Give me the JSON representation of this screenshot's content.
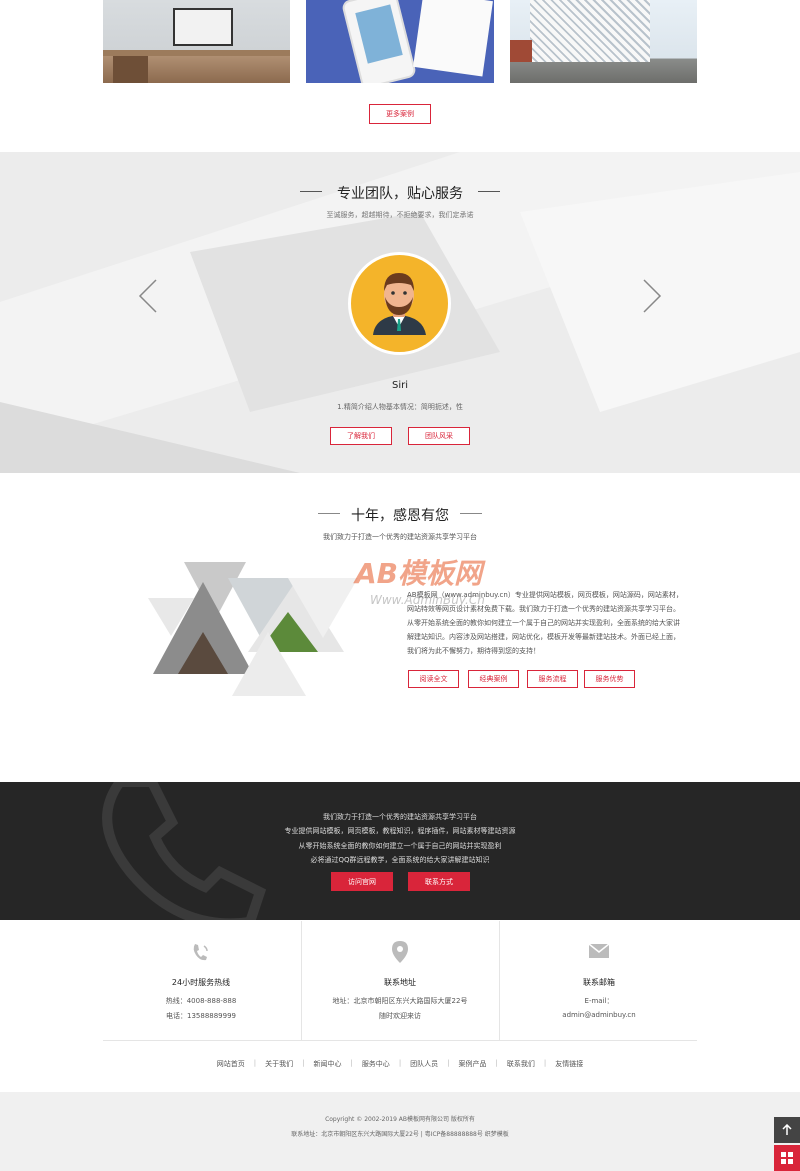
{
  "portfolio": {
    "more_label": "更多案例"
  },
  "team": {
    "title": "专业团队，贴心服务",
    "subtitle": "至诚服务，超越期待，不拒绝要求，我们定承诺",
    "member_name": "Siri",
    "member_desc": "1.精简介绍人物基本情况：简明扼述，性",
    "btn_about": "了解我们",
    "btn_style": "团队风采"
  },
  "about": {
    "title": "十年，感恩有您",
    "subtitle": "我们致力于打造一个优秀的建站资源共享学习平台",
    "text_lines": [
      "AB模板网（www.adminbuy.cn）专业提供网站模板，网页模板，网站源码，网站素材，",
      "网站特效等网页设计素材免费下载。我们致力于打造一个优秀的建站资源共享学习平台。",
      "从零开始系统全面的教你如何建立一个属于自己的网站并实现盈利，全面系统的给大家讲",
      "解建站知识。内容涉及网站搭建，网站优化，模板开发等最新建站技术。外面已经上面，",
      "我们将为此不懈努力，期待得到您的支持！"
    ],
    "buttons": [
      "阅读全文",
      "经典案例",
      "服务流程",
      "服务优势"
    ],
    "watermark_logo": "AB模板网",
    "watermark_url": "Www.AdminBuy.Cn"
  },
  "band": {
    "lines": [
      "我们致力于打造一个优秀的建站资源共享学习平台",
      "专业提供网站模板，网页模板，教程知识，程序插件，网站素材等建站资源",
      "从零开始系统全面的教你如何建立一个属于自己的网站并实现盈利",
      "必将通过QQ群远程教学，全面系统的给大家讲解建站知识"
    ],
    "btn_official": "访问官网",
    "btn_contact": "联系方式"
  },
  "contact": {
    "hotline": {
      "title": "24小时服务热线",
      "line1": "热线：4008-888-888",
      "line2": "电话：13588889999",
      "icon": "phone-icon"
    },
    "address": {
      "title": "联系地址",
      "line1": "地址：北京市朝阳区东兴大路国际大厦22号",
      "line2": "随时欢迎来访",
      "icon": "location-pin-icon"
    },
    "email": {
      "title": "联系邮箱",
      "line1": "E-mail：",
      "line2": "admin@adminbuy.cn",
      "icon": "mail-icon"
    }
  },
  "footer_nav": [
    "网站首页",
    "关于我们",
    "新闻中心",
    "服务中心",
    "团队人员",
    "案例产品",
    "联系我们",
    "友情链接"
  ],
  "copyright": {
    "line1": "Copyright © 2002-2019 AB模板网有限公司 版权所有",
    "line2": "联系地址：北京市朝阳区东兴大路国际大厦22号 | 粤ICP备88888888号 织梦模板"
  },
  "colors": {
    "accent": "#d9253a",
    "dark": "#262626",
    "avatar": "#f4b42a"
  }
}
